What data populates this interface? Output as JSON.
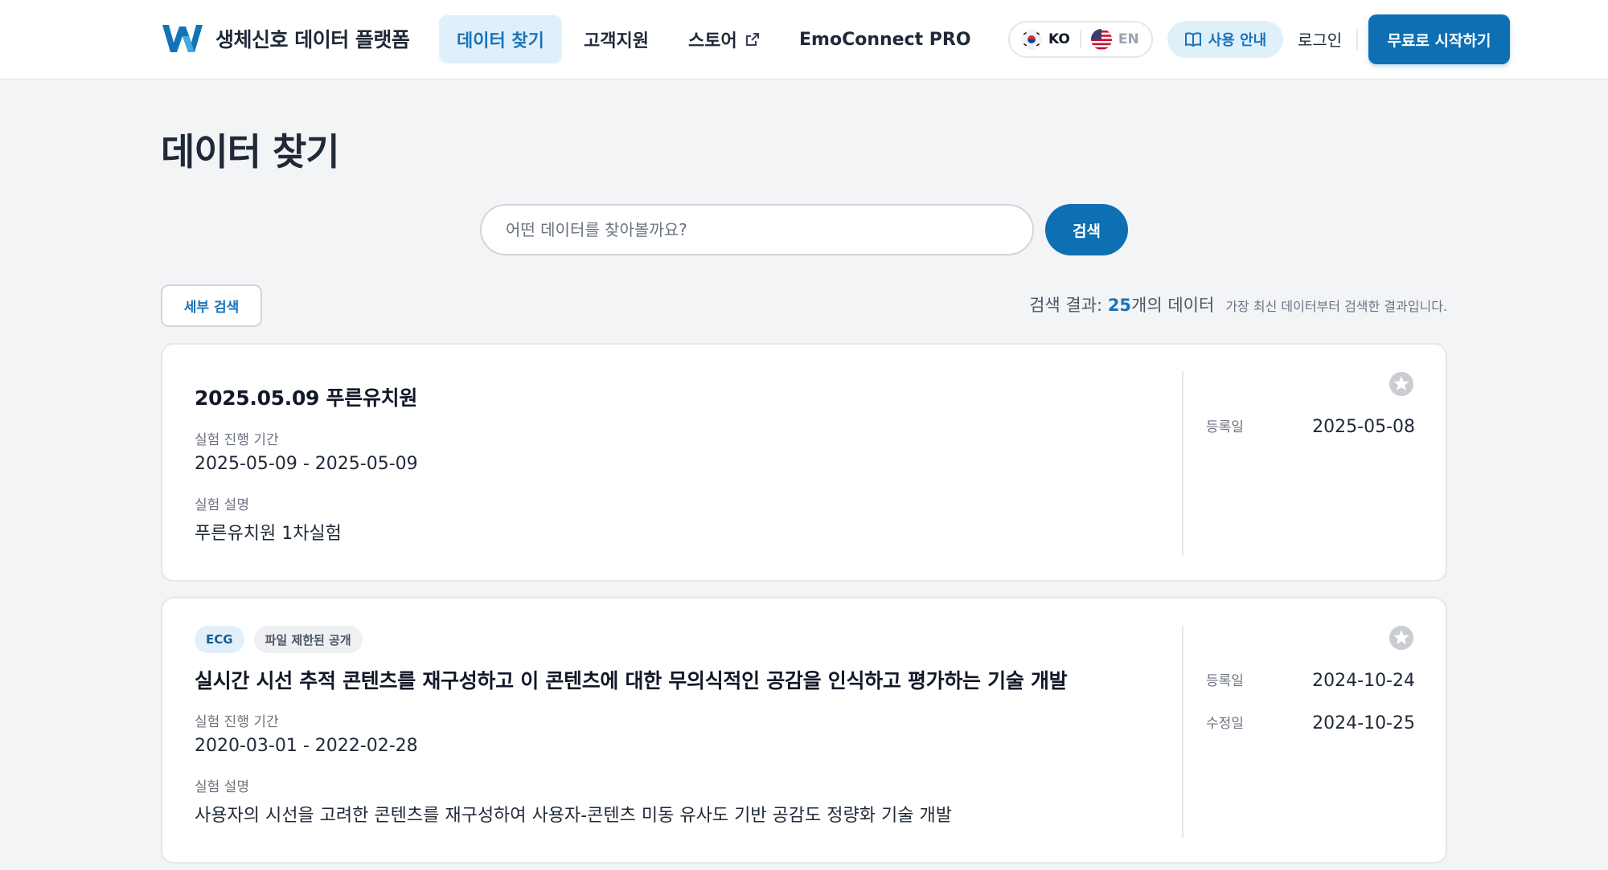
{
  "header": {
    "logo_text": "생체신호 데이터 플랫폼",
    "nav": [
      {
        "label": "데이터 찾기"
      },
      {
        "label": "고객지원"
      },
      {
        "label": "스토어"
      },
      {
        "label": "EmoConnect PRO"
      }
    ],
    "lang": {
      "ko": "KO",
      "en": "EN"
    },
    "guide_label": "사용 안내",
    "login_label": "로그인",
    "start_label": "무료로 시작하기"
  },
  "page": {
    "title": "데이터 찾기",
    "search_placeholder": "어떤 데이터를 찾아볼까요?",
    "search_button": "검색",
    "filter_button": "세부 검색",
    "result_prefix": "검색 결과: ",
    "result_count": "25",
    "result_suffix": "개의 데이터",
    "result_note": "가장 최신 데이터부터 검색한 결과입니다."
  },
  "cards": [
    {
      "badges": [],
      "title": "2025.05.09 푸른유치원",
      "period_label": "실험 진행 기간",
      "period": "2025-05-09 - 2025-05-09",
      "desc_label": "실험 설명",
      "desc": "푸른유치원 1차실험",
      "registered_label": "등록일",
      "registered": "2025-05-08"
    },
    {
      "badges": [
        "ECG",
        "파일 제한된 공개"
      ],
      "title": "실시간 시선 추적 콘텐츠를 재구성하고 이 콘텐츠에 대한 무의식적인 공감을 인식하고 평가하는 기술 개발",
      "period_label": "실험 진행 기간",
      "period": "2020-03-01 - 2022-02-28",
      "desc_label": "실험 설명",
      "desc": "사용자의 시선을 고려한 콘텐츠를 재구성하여 사용자-콘텐츠 미동 유사도 기반 공감도 정량화 기술 개발",
      "registered_label": "등록일",
      "registered": "2024-10-24",
      "modified_label": "수정일",
      "modified": "2024-10-25"
    }
  ],
  "colors": {
    "primary": "#0e6fb3",
    "primary_light": "#e0f0fb",
    "page_bg": "#f3f4f6"
  }
}
